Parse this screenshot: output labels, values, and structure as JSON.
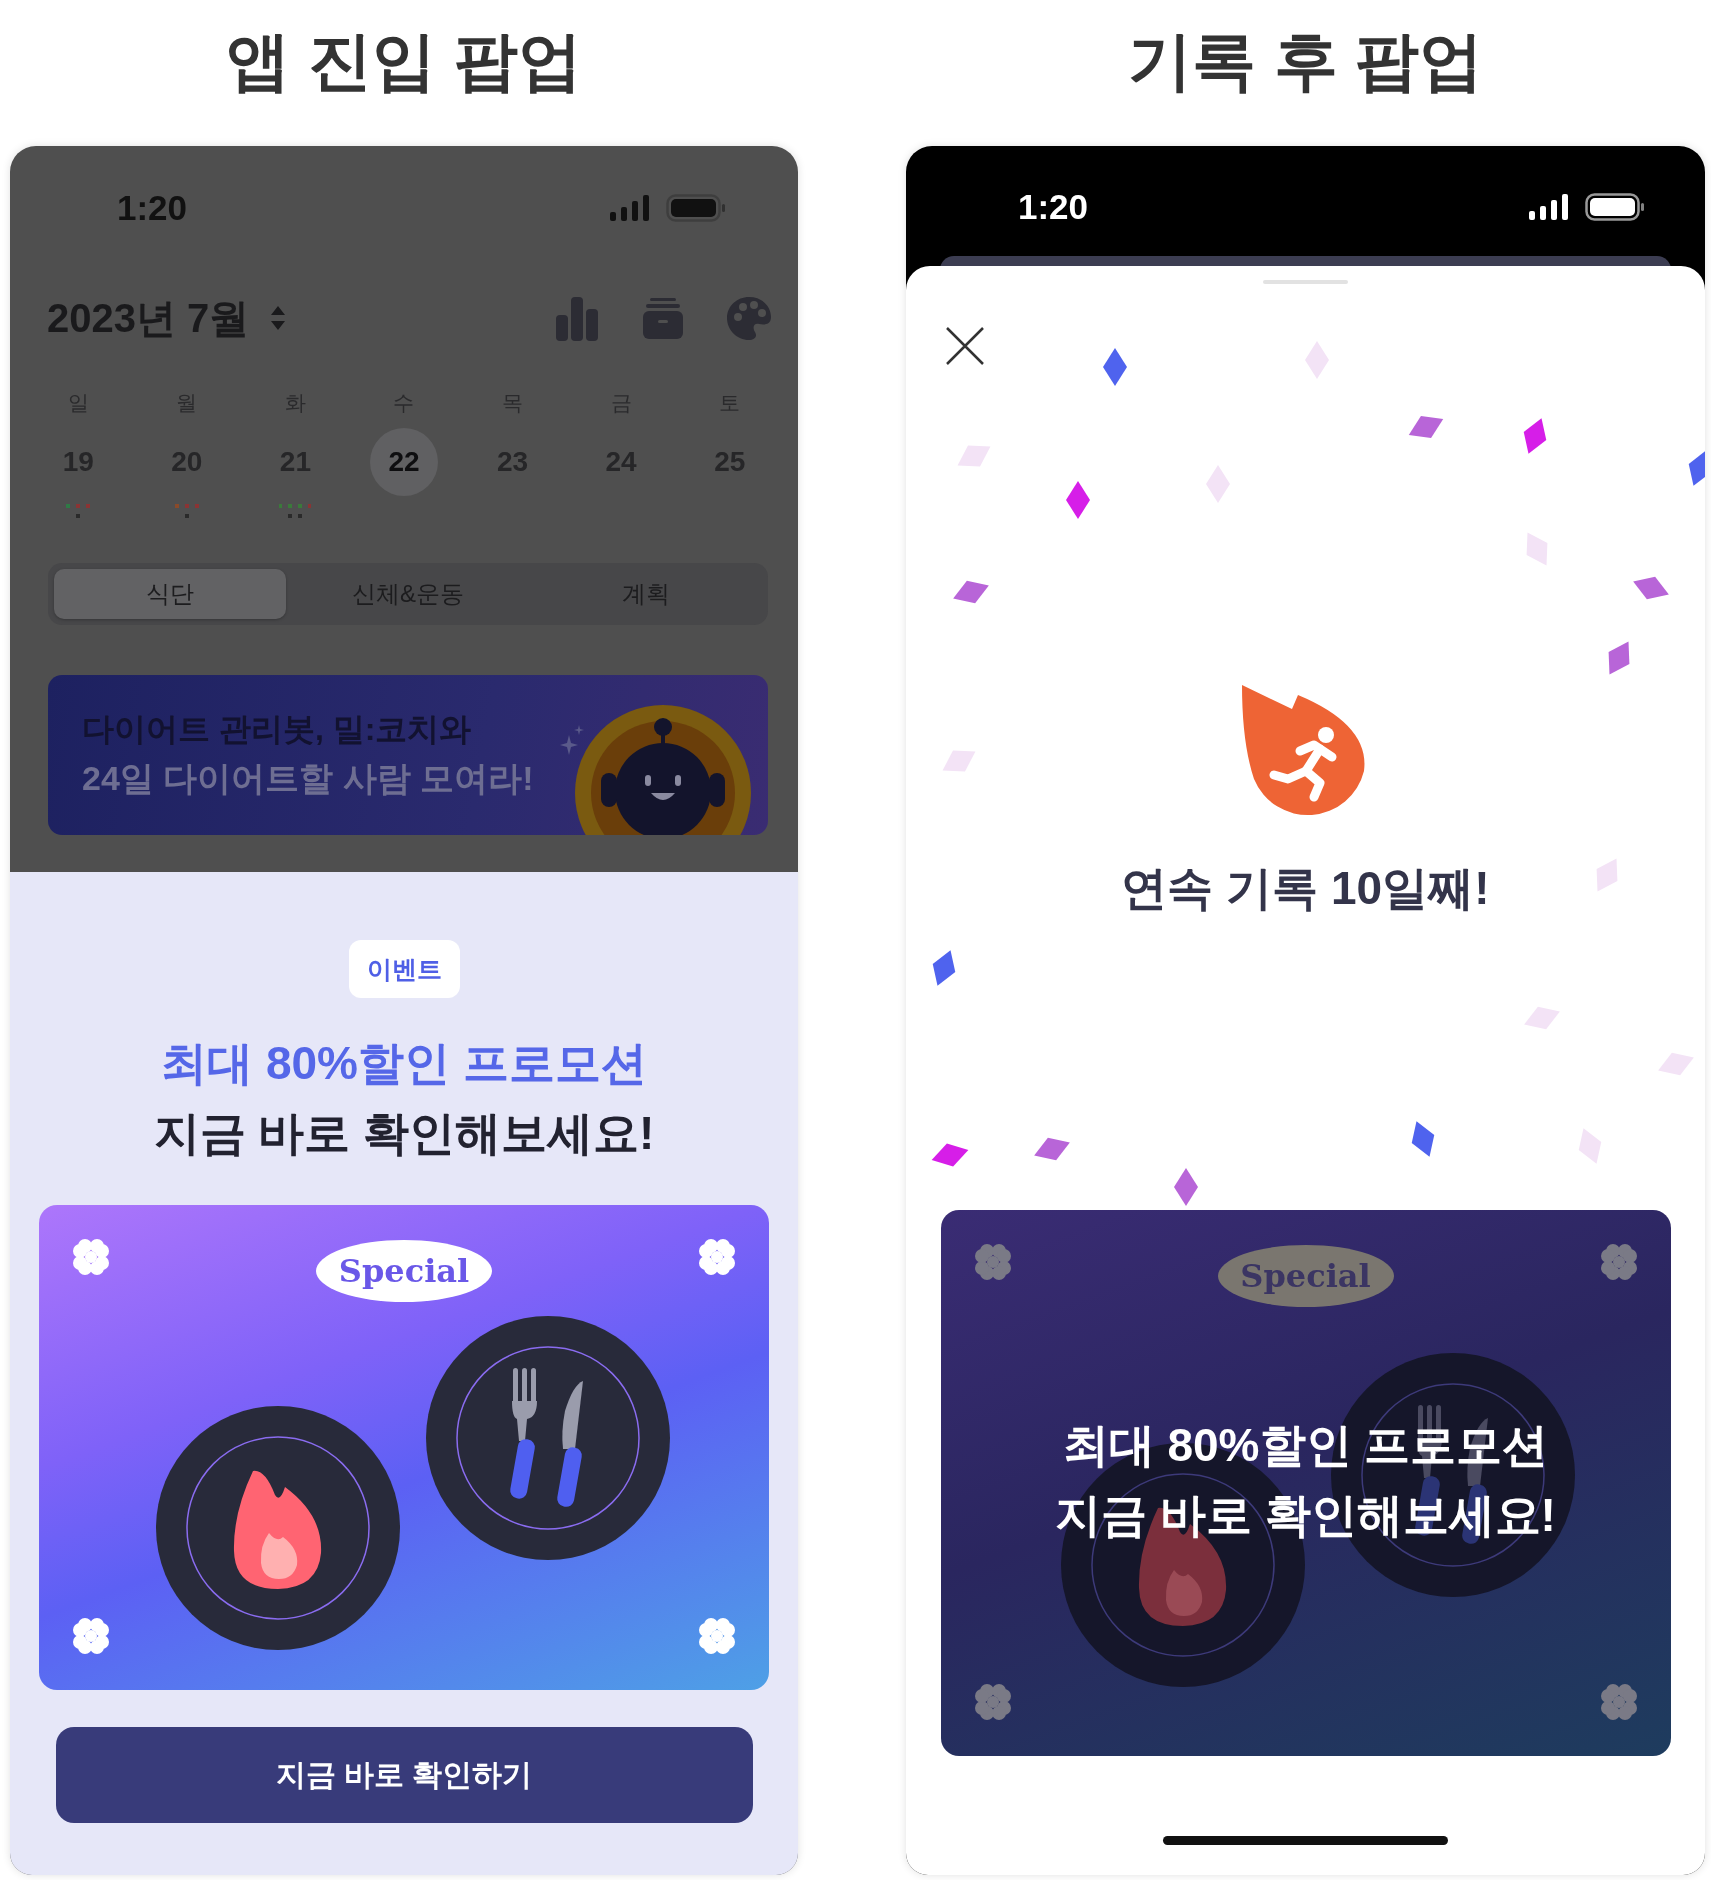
{
  "screens": [
    {
      "kind": "entry",
      "heading": "앱 진입 팝업",
      "status_time": "1:20",
      "month": "2023년 7월",
      "weekdays": [
        "일",
        "월",
        "화",
        "수",
        "목",
        "금",
        "토"
      ],
      "days": [
        {
          "date": "19",
          "selected": false,
          "has_records": true
        },
        {
          "date": "20",
          "selected": false,
          "has_records": true
        },
        {
          "date": "21",
          "selected": false,
          "has_records": true
        },
        {
          "date": "22",
          "selected": true,
          "has_records": false
        },
        {
          "date": "23",
          "selected": false,
          "has_records": false
        },
        {
          "date": "24",
          "selected": false,
          "has_records": false
        },
        {
          "date": "25",
          "selected": false,
          "has_records": false
        }
      ],
      "tabs": [
        {
          "label": "식단",
          "selected": true
        },
        {
          "label": "신체&운동",
          "selected": false
        },
        {
          "label": "계획",
          "selected": false
        }
      ],
      "banner": {
        "line_1": "다이어트 관리봇, 밀:코치와",
        "line_2": "24일 다이어트할 사람 모여라!"
      },
      "popup": {
        "badge": "이벤트",
        "headline": "최대 80%할인 프로모션",
        "subheadline": "지금 바로 확인해보세요!",
        "card": {
          "tag": "Special"
        },
        "button": "지금 바로 확인하기"
      }
    },
    {
      "kind": "streak",
      "heading": "기록 후 팝업",
      "status_time": "1:20",
      "message": "연속 기록 10일째!",
      "card": {
        "tag": "Special",
        "headline": "최대 80%할인 프로모션",
        "subheadline": "지금 바로 확인해보세요!"
      }
    }
  ]
}
